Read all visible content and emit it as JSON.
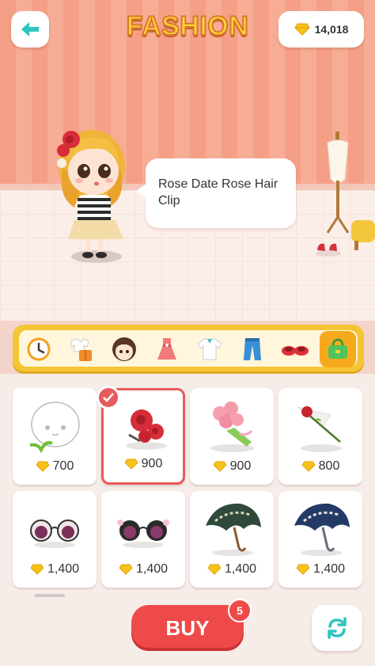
{
  "header": {
    "title": "FASHION",
    "gems": "14,018"
  },
  "character": {
    "speech": "Rose Date Rose Hair Clip"
  },
  "categories": [
    {
      "icon": "clock-icon",
      "active": false
    },
    {
      "icon": "outfit-icon",
      "active": false
    },
    {
      "icon": "face-icon",
      "active": false
    },
    {
      "icon": "dress-icon",
      "active": false
    },
    {
      "icon": "shirt-icon",
      "active": false
    },
    {
      "icon": "pants-icon",
      "active": false
    },
    {
      "icon": "shoes-icon",
      "active": false
    },
    {
      "icon": "bag-icon",
      "active": true
    }
  ],
  "items": [
    {
      "name": "head-accessory-placeholder",
      "price": "700",
      "selected": false
    },
    {
      "name": "rose-hair-clip",
      "price": "900",
      "selected": true
    },
    {
      "name": "rose-bouquet",
      "price": "900",
      "selected": false
    },
    {
      "name": "single-rose",
      "price": "800",
      "selected": false
    },
    {
      "name": "white-sunglasses",
      "price": "1,400",
      "selected": false
    },
    {
      "name": "black-sunglasses",
      "price": "1,400",
      "selected": false
    },
    {
      "name": "green-umbrella",
      "price": "1,400",
      "selected": false
    },
    {
      "name": "navy-umbrella",
      "price": "1,400",
      "selected": false
    }
  ],
  "footer": {
    "buy_label": "BUY",
    "cart_count": "5"
  },
  "colors": {
    "accent": "#ef4a4a",
    "category_bar": "#f4c534",
    "gem": "#f7c21a",
    "back": "#2ec4c0"
  }
}
